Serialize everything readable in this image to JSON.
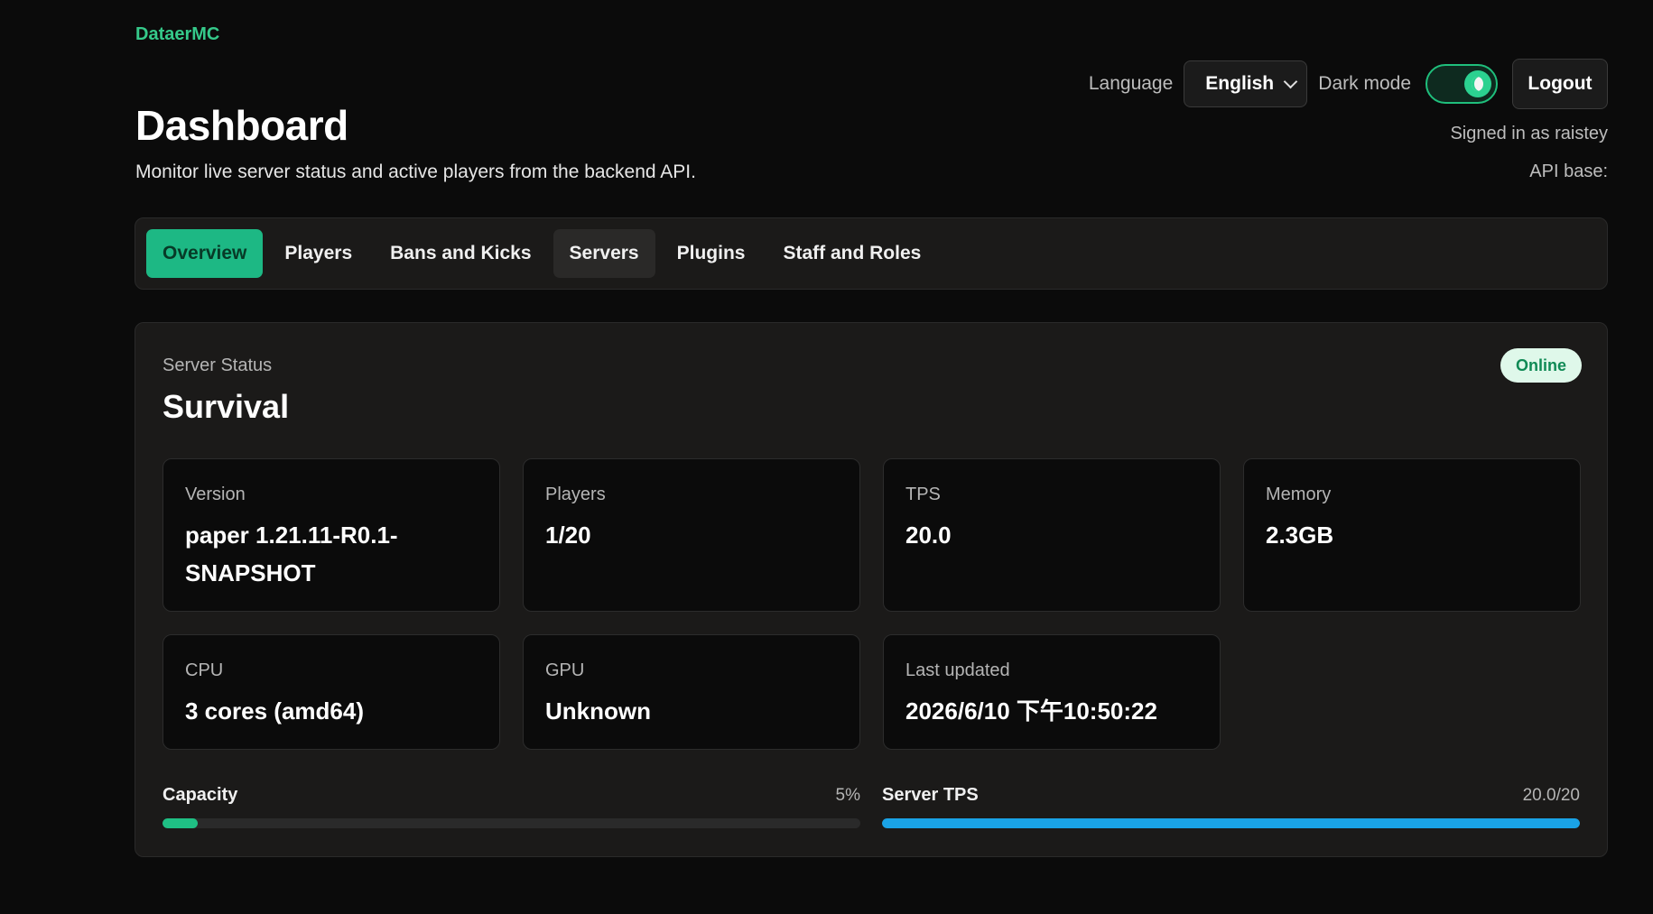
{
  "brand": "DataerMC",
  "header": {
    "title": "Dashboard",
    "subtitle": "Monitor live server status and active players from the backend API."
  },
  "controls": {
    "language_label": "Language",
    "language_value": "English",
    "dark_mode_label": "Dark mode",
    "dark_mode_on": true,
    "logout_label": "Logout",
    "signed_in": "Signed in as raistey",
    "api_base": "API base:"
  },
  "tabs": [
    {
      "label": "Overview",
      "active": true
    },
    {
      "label": "Players"
    },
    {
      "label": "Bans and Kicks"
    },
    {
      "label": "Servers"
    },
    {
      "label": "Plugins"
    },
    {
      "label": "Staff and Roles"
    }
  ],
  "status": {
    "eyebrow": "Server Status",
    "server_name": "Survival",
    "badge": "Online",
    "cards": [
      {
        "label": "Version",
        "value": "paper 1.21.11-R0.1-SNAPSHOT"
      },
      {
        "label": "Players",
        "value": "1/20"
      },
      {
        "label": "TPS",
        "value": "20.0"
      },
      {
        "label": "Memory",
        "value": "2.3GB"
      },
      {
        "label": "CPU",
        "value": "3 cores (amd64)"
      },
      {
        "label": "GPU",
        "value": "Unknown"
      },
      {
        "label": "Last updated",
        "value": "2026/6/10 下午10:50:22"
      }
    ],
    "capacity": {
      "label": "Capacity",
      "value": "5%",
      "fraction": 0.05
    },
    "server_tps": {
      "label": "Server TPS",
      "value": "20.0/20",
      "fraction": 1.0
    }
  },
  "colors": {
    "accent": "#1db884",
    "brand": "#35c98a",
    "tps_bar": "#1aa3e6",
    "online_badge_bg": "#dff8ea"
  }
}
